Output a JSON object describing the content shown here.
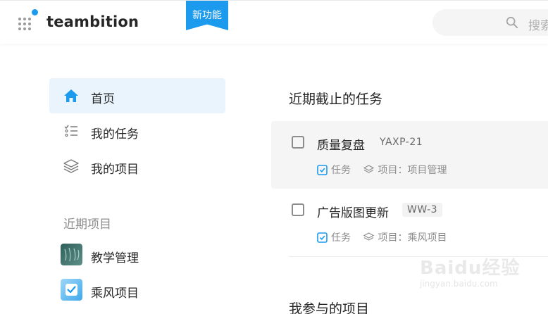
{
  "header": {
    "logo": "teambition",
    "new_badge": "新功能",
    "search_placeholder": "搜索"
  },
  "sidebar": {
    "nav": [
      {
        "label": "首页",
        "icon": "home-icon",
        "active": true
      },
      {
        "label": "我的任务",
        "icon": "task-list-icon",
        "active": false
      },
      {
        "label": "我的项目",
        "icon": "layers-icon",
        "active": false
      }
    ],
    "recent_title": "近期项目",
    "recent_projects": [
      {
        "label": "教学管理"
      },
      {
        "label": "乘风项目"
      }
    ]
  },
  "main": {
    "upcoming_title": "近期截止的任务",
    "tasks": [
      {
        "name": "质量复盘",
        "id": "YAXP-21",
        "type": "任务",
        "project": "项目：项目管理"
      },
      {
        "name": "广告版图更新",
        "id": "WW-3",
        "type": "任务",
        "project": "项目：乘风项目"
      }
    ],
    "my_projects_title": "我参与的项目"
  },
  "watermark": {
    "brand": "Baidu经验",
    "url": "jingyan.baidu.com"
  },
  "colors": {
    "accent": "#1b9aee",
    "active_bg": "#eaf4fc"
  }
}
